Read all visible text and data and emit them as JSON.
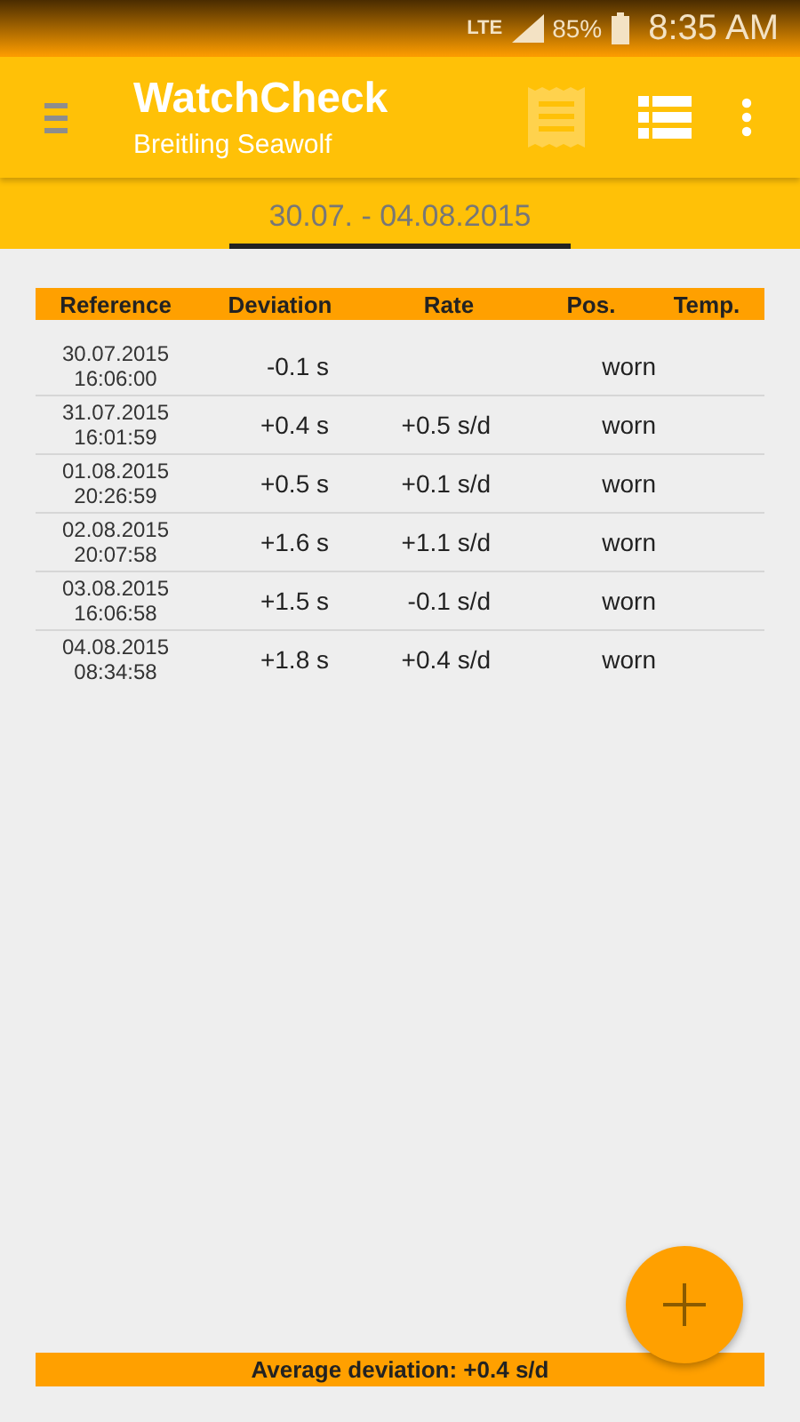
{
  "status_bar": {
    "network": "LTE",
    "battery": "85%",
    "time": "8:35 AM"
  },
  "app_bar": {
    "title": "WatchCheck",
    "subtitle": "Breitling Seawolf"
  },
  "tabs": [
    {
      "label": "30.07. - 04.08.2015",
      "selected": true
    }
  ],
  "table": {
    "columns": [
      "Reference",
      "Deviation",
      "Rate",
      "Pos.",
      "Temp."
    ],
    "rows": [
      {
        "date": "30.07.2015",
        "time": "16:06:00",
        "deviation": "-0.1 s",
        "position": "worn"
      },
      {
        "date": "31.07.2015",
        "time": "16:01:59",
        "deviation": "+0.4 s",
        "rate": "+0.5 s/d",
        "position": "worn"
      },
      {
        "date": "01.08.2015",
        "time": "20:26:59",
        "deviation": "+0.5 s",
        "rate": "+0.1 s/d",
        "position": "worn"
      },
      {
        "date": "02.08.2015",
        "time": "20:07:58",
        "deviation": "+1.6 s",
        "rate": "+1.1 s/d",
        "position": "worn"
      },
      {
        "date": "03.08.2015",
        "time": "16:06:58",
        "deviation": "+1.5 s",
        "rate": "-0.1 s/d",
        "position": "worn"
      },
      {
        "date": "04.08.2015",
        "time": "08:34:58",
        "deviation": "+1.8 s",
        "rate": "+0.4 s/d",
        "position": "worn"
      }
    ]
  },
  "summary": "Average deviation: +0.4 s/d"
}
